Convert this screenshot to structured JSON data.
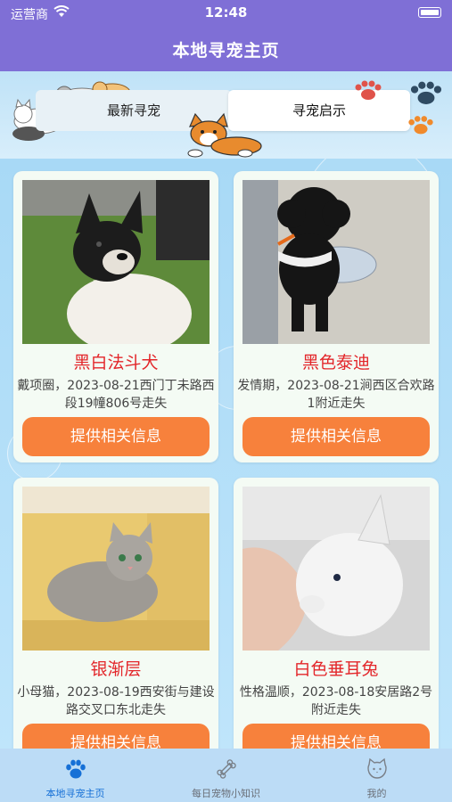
{
  "status": {
    "carrier": "运营商",
    "time": "12:48"
  },
  "nav": {
    "title": "本地寻宠主页"
  },
  "tabs": {
    "latest": "最新寻宠",
    "notice": "寻宠启示"
  },
  "cards": [
    {
      "name": "黑白法斗犬",
      "desc": "戴项圈，2023-08-21西门丁未路西段19幢806号走失",
      "button": "提供相关信息"
    },
    {
      "name": "黑色泰迪",
      "desc": "发情期，2023-08-21涧西区合欢路1附近走失",
      "button": "提供相关信息"
    },
    {
      "name": "银渐层",
      "desc": "小母猫，2023-08-19西安街与建设路交叉口东北走失",
      "button": "提供相关信息"
    },
    {
      "name": "白色垂耳兔",
      "desc": "性格温顺，2023-08-18安居路2号附近走失",
      "button": "提供相关信息"
    }
  ],
  "tabbar": [
    {
      "label": "本地寻宠主页",
      "icon": "paw-icon",
      "active": true
    },
    {
      "label": "每日宠物小知识",
      "icon": "bone-icon",
      "active": false
    },
    {
      "label": "我的",
      "icon": "cat-face-icon",
      "active": false
    }
  ],
  "colors": {
    "accent": "#7f6fd6",
    "button": "#f7813c",
    "name": "#e3262a",
    "active_tab": "#1670d6"
  }
}
